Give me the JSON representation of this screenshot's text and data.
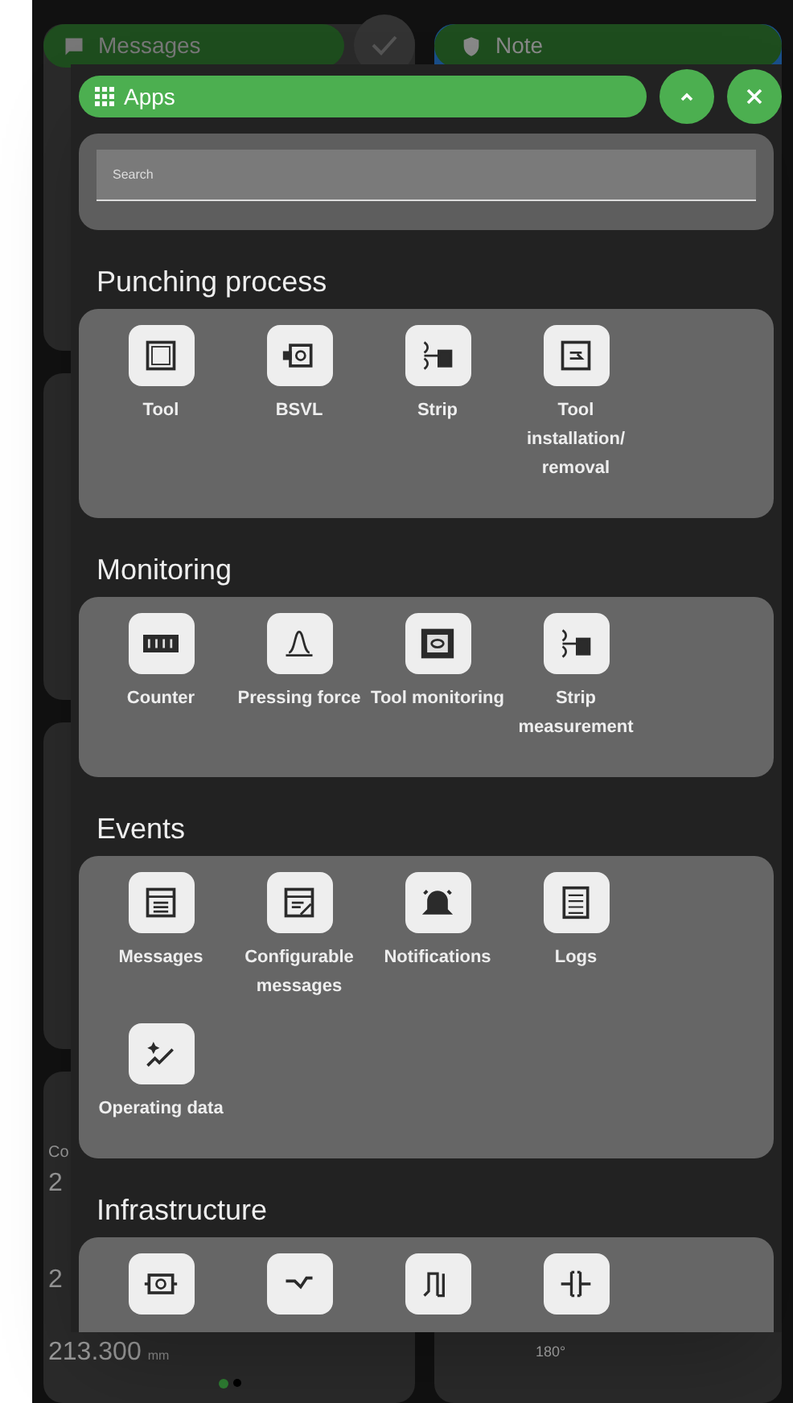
{
  "background": {
    "tiles": [
      {
        "title": "Messages"
      },
      {
        "title": "Note"
      }
    ],
    "fragments": [
      "Co",
      "2",
      "2"
    ],
    "reading": {
      "value": "213.300",
      "unit": "mm"
    },
    "right_reading": "180°",
    "page_dots": [
      {
        "selected": true
      },
      {
        "selected": false
      }
    ]
  },
  "apps_panel": {
    "title": "Apps",
    "search": {
      "placeholder": "Search"
    },
    "sections": [
      {
        "title": "Punching process",
        "items": [
          {
            "label": "Tool"
          },
          {
            "label": "BSVL"
          },
          {
            "label": "Strip"
          },
          {
            "label": "Tool installation/ removal"
          }
        ]
      },
      {
        "title": "Monitoring",
        "items": [
          {
            "label": "Counter"
          },
          {
            "label": "Pressing force"
          },
          {
            "label": "Tool monitoring"
          },
          {
            "label": "Strip measurement"
          }
        ]
      },
      {
        "title": "Events",
        "items": [
          {
            "label": "Messages"
          },
          {
            "label": "Configurable messages"
          },
          {
            "label": "Notifications"
          },
          {
            "label": "Logs"
          },
          {
            "label": "Operating data"
          }
        ]
      },
      {
        "title": "Infrastructure"
      }
    ]
  }
}
